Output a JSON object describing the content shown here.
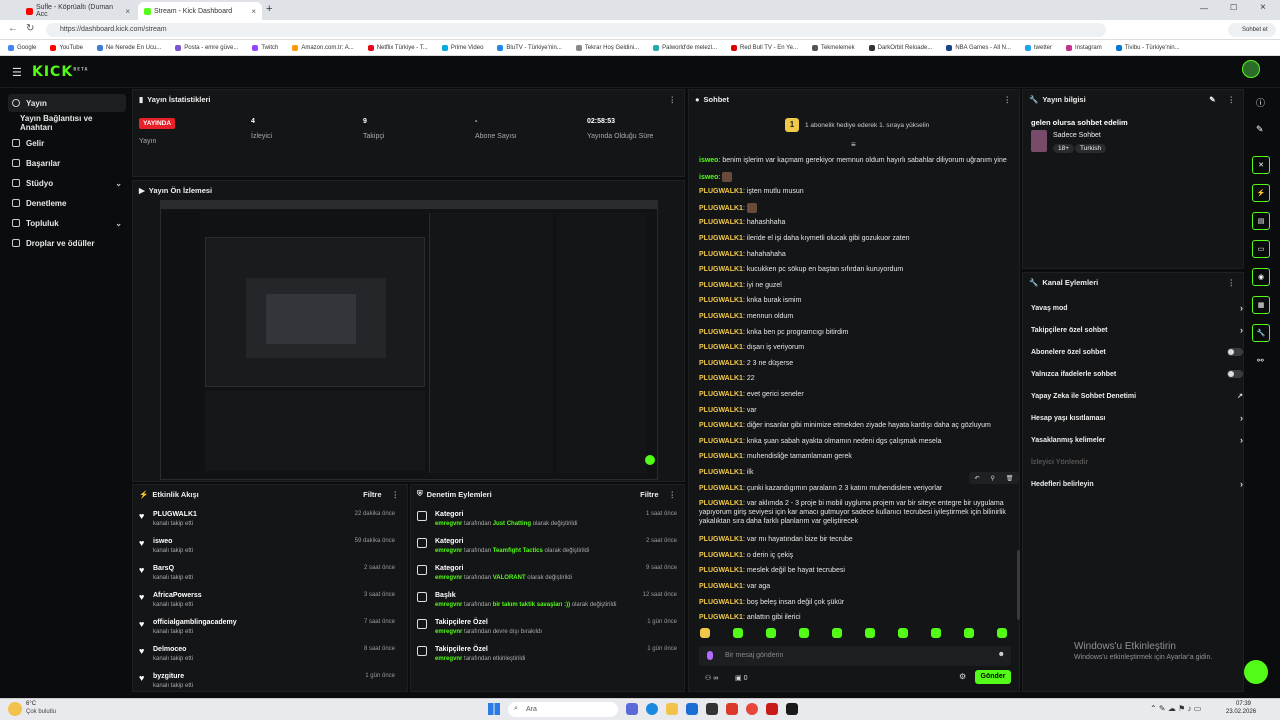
{
  "browser": {
    "tabs": [
      {
        "label": "Sufle - Köprüaltı (Duman Acc"
      },
      {
        "label": "Stream - Kick Dashboard"
      }
    ],
    "url": "https://dashboard.kick.com/stream",
    "bookmarks": [
      "Google",
      "YouTube",
      "Ne Nerede En Ucu...",
      "Posta - emre güve...",
      "Twitch",
      "Amazon.com.tr: A...",
      "Netflix Türkiye - T...",
      "Prime Video",
      "BluTV - Türkiye'nin...",
      "Tekrar Hoş Geldini...",
      "Palworld'de melezl...",
      "Red Bull TV - En Ye...",
      "Tekmelemek",
      "DarkOrbit Reloade...",
      "NBA Games - All N...",
      "twetter",
      "Instagram",
      "Tivibu - Türkiye'nin..."
    ],
    "chat_label": "Sohbet et"
  },
  "brand": {
    "logo": "KICK",
    "beta": "BETA",
    "accent": "#53fc18"
  },
  "sidebar": {
    "items": [
      {
        "label": "Yayın"
      },
      {
        "label": "Yayın Bağlantısı ve Anahtarı"
      },
      {
        "label": "Gelir"
      },
      {
        "label": "Başarılar"
      },
      {
        "label": "Stüdyo"
      },
      {
        "label": "Denetleme"
      },
      {
        "label": "Topluluk"
      },
      {
        "label": "Droplar ve ödüller"
      }
    ]
  },
  "stats": {
    "title": "Yayın İstatistikleri",
    "badge": "YAYINDA",
    "badge_sub": "Yayın",
    "items": [
      {
        "value": "4",
        "label": "İzleyici"
      },
      {
        "value": "9",
        "label": "Takipçi"
      },
      {
        "value": "-",
        "label": "Abone Sayısı"
      },
      {
        "value": "02:58:53",
        "label": "Yayında Olduğu Süre"
      }
    ]
  },
  "preview": {
    "title": "Yayın Ön İzlemesi"
  },
  "activity": {
    "title": "Etkinlik Akışı",
    "filter": "Filtre",
    "items": [
      {
        "name": "PLUGWALK1",
        "sub": "kanalı takip etti",
        "time": "22 dakika önce"
      },
      {
        "name": "isweo",
        "sub": "kanalı takip etti",
        "time": "59 dakika önce"
      },
      {
        "name": "BarsQ",
        "sub": "kanalı takip etti",
        "time": "2 saat önce"
      },
      {
        "name": "AfricaPowerss",
        "sub": "kanalı takip etti",
        "time": "3 saat önce"
      },
      {
        "name": "officialgamblingacademy",
        "sub": "kanalı takip etti",
        "time": "7 saat önce"
      },
      {
        "name": "Delmoceo",
        "sub": "kanalı takip etti",
        "time": "8 saat önce"
      },
      {
        "name": "byzgiture",
        "sub": "kanalı takip etti",
        "time": "1 gün önce"
      }
    ]
  },
  "modactions": {
    "title": "Denetim Eylemleri",
    "filter": "Filtre",
    "items": [
      {
        "name": "Kategori",
        "user": "emregvnr",
        "mid": " tarafından ",
        "val": "Just Chatting",
        "end": " olarak değiştirildi",
        "time": "1 saat önce"
      },
      {
        "name": "Kategori",
        "user": "emregvnr",
        "mid": " tarafından ",
        "val": "Teamfight Tactics",
        "end": " olarak değiştirildi",
        "time": "2 saat önce"
      },
      {
        "name": "Kategori",
        "user": "emregvnr",
        "mid": " tarafından ",
        "val": "VALORANT",
        "end": " olarak değiştirildi",
        "time": "9 saat önce"
      },
      {
        "name": "Başlık",
        "user": "emregvnr",
        "mid": " tarafından ",
        "val": "bir takım taktik savaşları :))",
        "end": " olarak değiştirildi",
        "time": "12 saat önce"
      },
      {
        "name": "Takipçilere Özel",
        "user": "emregvnr",
        "mid": " tarafından devre dışı bırakıldı",
        "val": "",
        "end": "",
        "time": "1 gün önce"
      },
      {
        "name": "Takipçilere Özel",
        "user": "emregvnr",
        "mid": " tarafından etkinleştirildi",
        "val": "",
        "end": "",
        "time": "1 gün önce"
      }
    ]
  },
  "chat": {
    "title": "Sohbet",
    "pinned": "1 abonelik hediye ederek 1. sıraya yükselin",
    "pinned_rank": "1",
    "placeholder": "Bir mesaj gönderin",
    "send": "Gönder",
    "points": "0",
    "messages": [
      {
        "user": "isweo",
        "color": "#53fc18",
        "text": "benim işlerim var kaçmam gerekiyor memnun oldum hayırlı sabahlar diliyorum uğranım yine"
      },
      {
        "user": "isweo",
        "color": "#53fc18",
        "text": ""
      },
      {
        "user": "PLUGWALK1",
        "color": "#f0c94a",
        "text": "işten mutlu musun"
      },
      {
        "user": "PLUGWALK1",
        "color": "#f0c94a",
        "text": ""
      },
      {
        "user": "PLUGWALK1",
        "color": "#f0c94a",
        "text": "hahashhaha"
      },
      {
        "user": "PLUGWALK1",
        "color": "#f0c94a",
        "text": "ileride el işi daha kıymetli olucak gibi gozukuor zaten"
      },
      {
        "user": "PLUGWALK1",
        "color": "#f0c94a",
        "text": "hahahahaha"
      },
      {
        "user": "PLUGWALK1",
        "color": "#f0c94a",
        "text": "kucukken pc sökup en baştan sıfırdan kuruyordum"
      },
      {
        "user": "PLUGWALK1",
        "color": "#f0c94a",
        "text": "iyi ne guzel"
      },
      {
        "user": "PLUGWALK1",
        "color": "#f0c94a",
        "text": "knka burak ismim"
      },
      {
        "user": "PLUGWALK1",
        "color": "#f0c94a",
        "text": "mennun oldum"
      },
      {
        "user": "PLUGWALK1",
        "color": "#f0c94a",
        "text": "knka ben pc programcıgı bitirdim"
      },
      {
        "user": "PLUGWALK1",
        "color": "#f0c94a",
        "text": "dışarı iş veriyorum"
      },
      {
        "user": "PLUGWALK1",
        "color": "#f0c94a",
        "text": "2 3 ne düşerse"
      },
      {
        "user": "PLUGWALK1",
        "color": "#f0c94a",
        "text": "22"
      },
      {
        "user": "PLUGWALK1",
        "color": "#f0c94a",
        "text": "evet gerici seneler"
      },
      {
        "user": "PLUGWALK1",
        "color": "#f0c94a",
        "text": "var"
      },
      {
        "user": "PLUGWALK1",
        "color": "#f0c94a",
        "text": "diğer insanlar gibi minimize etmekden ziyade hayata kardışı daha aç gözluyum"
      },
      {
        "user": "PLUGWALK1",
        "color": "#f0c94a",
        "text": "knka şuan sabah ayakta olmamın nedeni dgs çalışmak mesela"
      },
      {
        "user": "PLUGWALK1",
        "color": "#f0c94a",
        "text": "muhendisliğe tamamlamam gerek"
      },
      {
        "user": "PLUGWALK1",
        "color": "#f0c94a",
        "text": "ilk"
      },
      {
        "user": "PLUGWALK1",
        "color": "#f0c94a",
        "text": "çunki kazandıgımın paraların 2 3 katını muhendislere veriyorlar"
      },
      {
        "user": "PLUGWALK1",
        "color": "#f0c94a",
        "text": "var aklımda 2 - 3 proje bi mobil uygluma projem var bir siteye entegre bir uygulama yapıyorum giriş seviyesi için kar amacı gutmuyor sadece kullanıcı tecrubesi iyileştirmek için bilinirlik yakalıktan sıra daha farklı planlarım var geliştirecek"
      },
      {
        "user": "PLUGWALK1",
        "color": "#f0c94a",
        "text": "var mı hayatından bize bir tecrube"
      },
      {
        "user": "PLUGWALK1",
        "color": "#f0c94a",
        "text": "o derin iç çekiş"
      },
      {
        "user": "PLUGWALK1",
        "color": "#f0c94a",
        "text": "meslek değil be hayat tecrubesi"
      },
      {
        "user": "PLUGWALK1",
        "color": "#f0c94a",
        "text": "var aga"
      },
      {
        "user": "PLUGWALK1",
        "color": "#f0c94a",
        "text": "boş beleş insan değil çok şükür"
      },
      {
        "user": "PLUGWALK1",
        "color": "#f0c94a",
        "text": "anlattın gibi ilerici"
      }
    ]
  },
  "streaminfo": {
    "title": "Yayın bilgisi",
    "stream_title": "gelen olursa sohbet edelim",
    "category": "Sadece Sohbet",
    "tags": [
      "18+",
      "Turkish"
    ]
  },
  "channel_actions": {
    "title": "Kanal Eylemleri",
    "items": [
      {
        "label": "Yavaş mod",
        "kind": "arrow"
      },
      {
        "label": "Takipçilere özel sohbet",
        "kind": "arrow"
      },
      {
        "label": "Abonelere özel sohbet",
        "kind": "toggle"
      },
      {
        "label": "Yalnızca ifadelerle sohbet",
        "kind": "toggle"
      },
      {
        "label": "Yapay Zeka ile Sohbet Denetimi",
        "kind": "link"
      },
      {
        "label": "Hesap yaşı kısıtlaması",
        "kind": "arrow"
      },
      {
        "label": "Yasaklanmış kelimeler",
        "kind": "arrow"
      },
      {
        "label": "İzleyici Yönlendir",
        "kind": "disabled"
      },
      {
        "label": "Hedefleri belirleyin",
        "kind": "arrow"
      }
    ]
  },
  "windows": {
    "activate_title": "Windows'u Etkinleştirin",
    "activate_sub": "Windows'u etkinleştirmek için Ayarlar'a gidin."
  },
  "taskbar": {
    "weather_temp": "6°C",
    "weather_desc": "Çok bulutlu",
    "search": "Ara",
    "time": "07:39",
    "date": "23.02.2026"
  }
}
